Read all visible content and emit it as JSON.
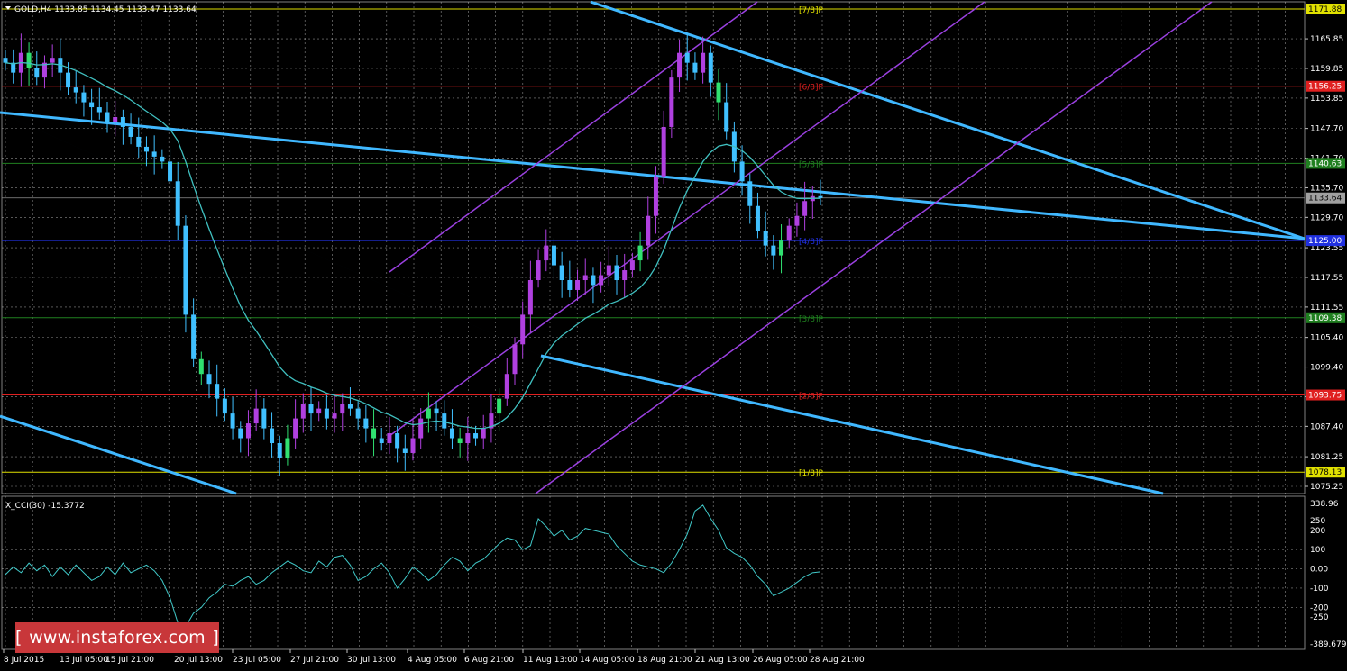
{
  "header": {
    "symbol_text": "GOLD,H4  1133.85 1134.45 1133.47 1133.64"
  },
  "indicator": {
    "label": "X_CCI(30) -15.3772"
  },
  "watermark": {
    "text": "www.instaforex.com",
    "open": "[",
    "close": "]"
  },
  "colors": {
    "bull": "#b040e0",
    "bear": "#40c0ff",
    "green_bull": "#30e070",
    "ma": "#40c0c0",
    "channel": "#40b8ff",
    "pitch": "#9a40e0",
    "grid": "#ffffff"
  },
  "chart_data": [
    {
      "type": "candlestick",
      "title": "GOLD,H4",
      "ylim": [
        1075.25,
        1171.88
      ],
      "yticks": [
        "1165.85",
        "1159.85",
        "1153.85",
        "1147.70",
        "1141.70",
        "1135.70",
        "1129.70",
        "1123.55",
        "1117.55",
        "1111.55",
        "1105.40",
        "1099.40",
        "1093.40",
        "1087.40",
        "1081.25",
        "1075.25"
      ],
      "price_labels": [
        {
          "label": "1171.88",
          "color": "#e0e000",
          "value": 1171.88
        },
        {
          "label": "1156.25",
          "color": "#e02020",
          "value": 1156.25
        },
        {
          "label": "1140.63",
          "color": "#208020",
          "value": 1140.63
        },
        {
          "label": "1133.64",
          "color": "#a0a0a0",
          "value": 1133.64
        },
        {
          "label": "1125.00",
          "color": "#2030e0",
          "value": 1125.0
        },
        {
          "label": "1109.38",
          "color": "#208020",
          "value": 1109.38
        },
        {
          "label": "1093.75",
          "color": "#e02020",
          "value": 1093.75
        },
        {
          "label": "1078.13",
          "color": "#e0e000",
          "value": 1078.13
        }
      ],
      "murrey": [
        {
          "label": "[7/8]P",
          "value": 1171.88,
          "color": "#e0e000"
        },
        {
          "label": "[6/8]P",
          "value": 1156.25,
          "color": "#e02020"
        },
        {
          "label": "[5/8]P",
          "value": 1140.63,
          "color": "#208020"
        },
        {
          "label": "[4/8]P",
          "value": 1125.0,
          "color": "#2030e0"
        },
        {
          "label": "[3/8]P",
          "value": 1109.38,
          "color": "#208020"
        },
        {
          "label": "[2/8]P",
          "value": 1093.75,
          "color": "#e02020"
        },
        {
          "label": "[1/8]P",
          "value": 1078.13,
          "color": "#e0e000"
        }
      ],
      "series_close": [
        1161,
        1159,
        1163,
        1160,
        1158,
        1161,
        1162,
        1159,
        1156,
        1155,
        1153,
        1152,
        1151,
        1149,
        1150,
        1148,
        1146,
        1144,
        1143,
        1142,
        1141,
        1137,
        1128,
        1110,
        1101,
        1098,
        1096,
        1093,
        1090,
        1087,
        1085,
        1088,
        1091,
        1087,
        1084,
        1081,
        1085,
        1089,
        1092,
        1090,
        1091,
        1089,
        1090,
        1092,
        1091,
        1089,
        1087,
        1085,
        1084,
        1086,
        1083,
        1082,
        1085,
        1089,
        1091,
        1090,
        1087,
        1085,
        1084,
        1086,
        1085,
        1087,
        1090,
        1093,
        1098,
        1104,
        1110,
        1117,
        1121,
        1124,
        1120,
        1117,
        1115,
        1117,
        1118,
        1116,
        1118,
        1120,
        1117,
        1119,
        1121,
        1124,
        1130,
        1138,
        1148,
        1158,
        1163,
        1161,
        1159,
        1163,
        1157,
        1153,
        1147,
        1141,
        1137,
        1132,
        1127,
        1124,
        1122,
        1125,
        1128,
        1130,
        1133,
        1134,
        1133.64
      ],
      "x_labels": [
        "8 Jul 2015",
        "13 Jul 05:00",
        "15 Jul 21:00",
        "20 Jul 13:00",
        "23 Jul 05:00",
        "27 Jul 21:00",
        "30 Jul 13:00",
        "4 Aug 05:00",
        "6 Aug 21:00",
        "11 Aug 13:00",
        "14 Aug 05:00",
        "18 Aug 21:00",
        "21 Aug 13:00",
        "26 Aug 05:00",
        "28 Aug 21:00"
      ]
    },
    {
      "type": "line",
      "title": "X_CCI(30) -15.3772",
      "ylim": [
        -389.6795,
        338.96
      ],
      "yticks": [
        "338.96",
        "250",
        "200",
        "100",
        "0.00",
        "-100",
        "-200",
        "-250",
        "-389.6795"
      ],
      "values": [
        -30,
        10,
        -20,
        30,
        -10,
        20,
        -40,
        10,
        -30,
        20,
        -20,
        -60,
        -40,
        10,
        -30,
        30,
        -20,
        0,
        20,
        -10,
        -60,
        -150,
        -280,
        -300,
        -230,
        -200,
        -150,
        -120,
        -80,
        -90,
        -60,
        -40,
        -80,
        -60,
        -20,
        10,
        40,
        20,
        -10,
        -20,
        40,
        10,
        60,
        70,
        20,
        -60,
        -40,
        0,
        30,
        -20,
        -100,
        -50,
        10,
        -20,
        -60,
        -30,
        20,
        60,
        40,
        -10,
        30,
        50,
        90,
        130,
        160,
        150,
        100,
        120,
        260,
        220,
        170,
        200,
        150,
        170,
        210,
        200,
        190,
        180,
        120,
        80,
        40,
        20,
        10,
        0,
        -20,
        30,
        100,
        180,
        300,
        330,
        260,
        200,
        110,
        80,
        60,
        20,
        -40,
        -80,
        -140,
        -120,
        -100,
        -70,
        -40,
        -20,
        -15.3772
      ]
    }
  ]
}
